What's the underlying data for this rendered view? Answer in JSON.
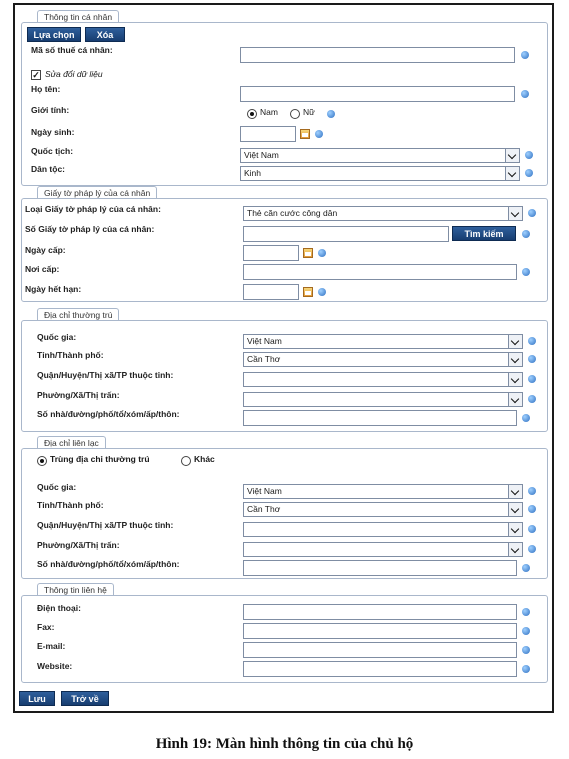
{
  "sections": {
    "personal": {
      "legend": "Thông tin cá nhân",
      "select_btn": "Lựa chọn",
      "delete_btn": "Xóa",
      "tax_code_label": "Mã số thuế cá nhân:",
      "edit_checkbox_label": "Sửa đổi dữ liệu",
      "fullname_label": "Họ tên:",
      "gender_label": "Giới tính:",
      "gender_male": "Nam",
      "gender_female": "Nữ",
      "dob_label": "Ngày sinh:",
      "nationality_label": "Quốc tịch:",
      "nationality_value": "Việt Nam",
      "ethnicity_label": "Dân tộc:",
      "ethnicity_value": "Kinh"
    },
    "legal_doc": {
      "legend": "Giấy tờ pháp lý của cá nhân",
      "type_label": "Loại Giấy tờ pháp lý của cá nhân:",
      "type_value": "Thẻ căn cước công dân",
      "number_label": "Số Giấy tờ pháp lý của cá nhân:",
      "search_btn": "Tìm kiếm",
      "issue_date_label": "Ngày cấp:",
      "issue_place_label": "Nơi cấp:",
      "expiry_label": "Ngày hết hạn:"
    },
    "permanent_address": {
      "legend": "Địa chỉ thường trú",
      "country_label": "Quốc gia:",
      "country_value": "Việt Nam",
      "province_label": "Tỉnh/Thành phố:",
      "province_value": "Cần Thơ",
      "district_label": "Quận/Huyện/Thị xã/TP thuộc tỉnh:",
      "ward_label": "Phường/Xã/Thị trấn:",
      "street_label": "Số nhà/đường/phố/tổ/xóm/ấp/thôn:"
    },
    "contact_address": {
      "legend": "Địa chỉ liên lạc",
      "same_as_permanent": "Trùng địa chỉ thường trú",
      "other": "Khác",
      "country_label": "Quốc gia:",
      "country_value": "Việt Nam",
      "province_label": "Tỉnh/Thành phố:",
      "province_value": "Cần Thơ",
      "district_label": "Quận/Huyện/Thị xã/TP thuộc tỉnh:",
      "ward_label": "Phường/Xã/Thị trấn:",
      "street_label": "Số nhà/đường/phố/tổ/xóm/ấp/thôn:"
    },
    "contact_info": {
      "legend": "Thông tin liên hệ",
      "phone_label": "Điện thoại:",
      "fax_label": "Fax:",
      "email_label": "E-mail:",
      "website_label": "Website:"
    }
  },
  "footer": {
    "save_btn": "Lưu",
    "back_btn": "Trở về"
  },
  "caption": "Hình 19: Màn hình thông tin của chủ hộ"
}
